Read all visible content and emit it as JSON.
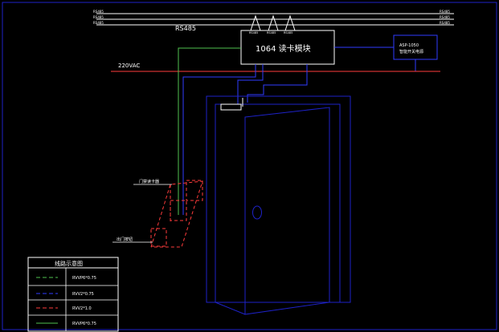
{
  "diagram": {
    "bus": {
      "label": "RS485",
      "left_tags": [
        "RS485",
        "RS485",
        "RS485"
      ],
      "right_tags": [
        "RS485",
        "RS485",
        "RS485"
      ],
      "drop_tags": [
        "RS485",
        "RS485",
        "RS485"
      ]
    },
    "power_label": "220VAC",
    "controller_label": "1064 读卡模块",
    "power_supply": {
      "line1": "ASP-1050",
      "line2": "智能开关电源"
    },
    "reader_label": "门禁读卡器",
    "exit_button_label": "出门按钮",
    "legend": {
      "title": "线路示意图",
      "entries": [
        {
          "label": "RVVP6*0.75",
          "color": "#4fc24f",
          "style": "dashed"
        },
        {
          "label": "RVV2*0.75",
          "color": "#2f3cff",
          "style": "dashed"
        },
        {
          "label": "RVV2*1.0",
          "color": "#ff3b3b",
          "style": "dashed"
        },
        {
          "label": "RVVP6*0.75",
          "color": "#4fc24f",
          "style": "solid"
        }
      ]
    },
    "colors": {
      "bus": "#ffffff",
      "power": "#ff3b3b",
      "blue": "#2f3cff",
      "green": "#4fc24f",
      "red_device": "#ff3b3b",
      "frame": "#1e22c8"
    }
  }
}
